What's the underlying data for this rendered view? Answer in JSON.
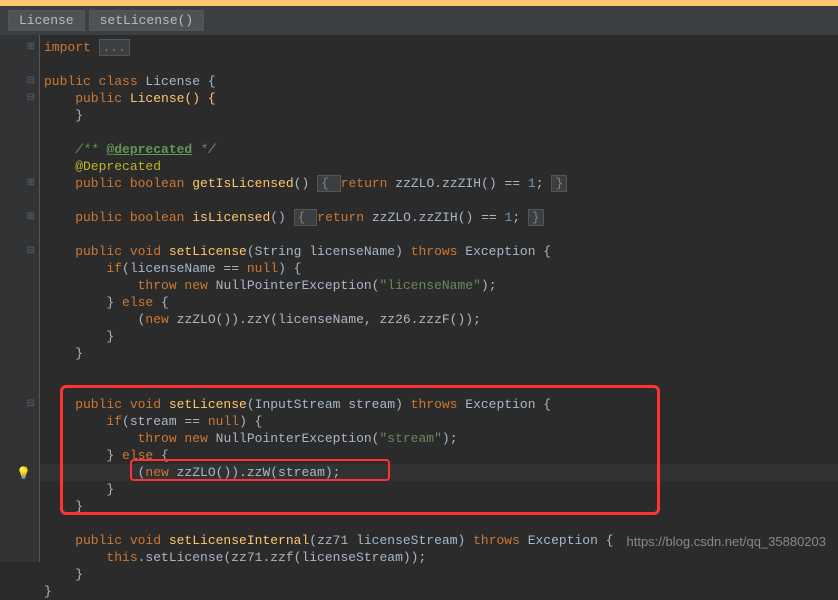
{
  "breadcrumb": {
    "items": [
      "License",
      "setLicense()"
    ]
  },
  "code": {
    "l1_import": "import ",
    "l1_fold": "...",
    "l2_pub": "public class ",
    "l2_class": "License {",
    "l3_pub": "    public ",
    "l3_ctor": "License() {",
    "l4": "    }",
    "l5_comment_open": "    /** ",
    "l5_tag": "@deprecated",
    "l5_comment_close": " */",
    "l6_ann": "    @Deprecated",
    "l7_mods": "    public boolean ",
    "l7_name": "getIsLicensed",
    "l7_sig": "() ",
    "l7_brace": "{ ",
    "l7_ret": "return ",
    "l7_body": "zzZLO.zzZIH() == ",
    "l7_num": "1",
    "l7_end": "; ",
    "l7_close": "}",
    "l8_mods": "    public boolean ",
    "l8_name": "isLicensed",
    "l8_sig": "() ",
    "l8_brace": "{ ",
    "l8_ret": "return ",
    "l8_body": "zzZLO.zzZIH() == ",
    "l8_num": "1",
    "l8_end": "; ",
    "l8_close": "}",
    "l9_mods": "    public void ",
    "l9_name": "setLicense",
    "l9_args": "(String licenseName) ",
    "l9_throws": "throws ",
    "l9_exc": "Exception {",
    "l10_if": "        if",
    "l10_cond": "(licenseName == ",
    "l10_null": "null",
    "l10_end": ") {",
    "l11_throw": "            throw new ",
    "l11_exc": "NullPointerException(",
    "l11_str": "\"licenseName\"",
    "l11_end": ");",
    "l12_else1": "        } ",
    "l12_else2": "else ",
    "l12_brace": "{",
    "l13_open": "            (",
    "l13_new": "new ",
    "l13_call": "zzZLO()).zzY(licenseName, zz26.zzzF());",
    "l14": "        }",
    "l15": "    }",
    "l16_mods": "    public void ",
    "l16_name": "setLicense",
    "l16_args": "(InputStream stream) ",
    "l16_throws": "throws ",
    "l16_exc": "Exception {",
    "l17_if": "        if",
    "l17_cond": "(stream == ",
    "l17_null": "null",
    "l17_end": ") {",
    "l18_throw": "            throw new ",
    "l18_exc": "NullPointerException(",
    "l18_str": "\"stream\"",
    "l18_end": ");",
    "l19_else1": "        } ",
    "l19_else2": "else ",
    "l19_brace": "{",
    "l20_open": "            (",
    "l20_new": "new ",
    "l20_call": "zzZLO()).zzW(stream);",
    "l21": "        }",
    "l22": "    }",
    "l23_mods": "    public void ",
    "l23_name": "setLicenseInternal",
    "l23_args": "(zz71 licenseStream) ",
    "l23_throws": "throws ",
    "l23_exc": "Exception {",
    "l24_this": "        this",
    "l24_call": ".setLicense(zz71.zzf(licenseStream));",
    "l25": "    }",
    "l26": "}"
  },
  "watermark": "https://blog.csdn.net/qq_35880203"
}
